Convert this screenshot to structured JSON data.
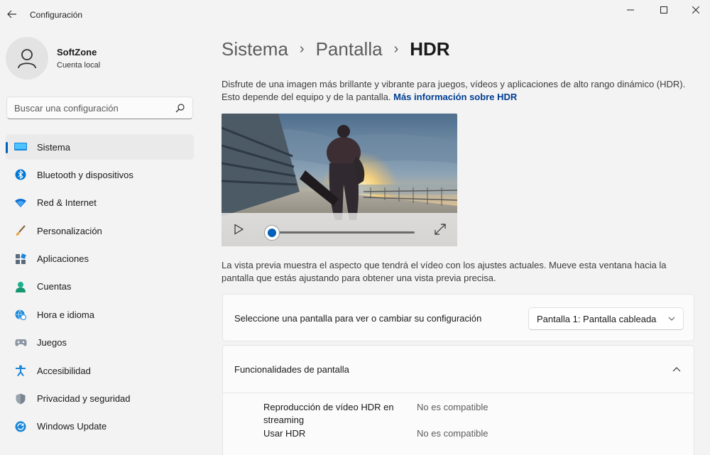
{
  "window": {
    "title": "Configuración"
  },
  "profile": {
    "name": "SoftZone",
    "account_type": "Cuenta local"
  },
  "search": {
    "placeholder": "Buscar una configuración"
  },
  "sidebar": {
    "items": [
      {
        "label": "Sistema",
        "icon": "system-icon",
        "active": true
      },
      {
        "label": "Bluetooth y dispositivos",
        "icon": "bluetooth-icon"
      },
      {
        "label": "Red & Internet",
        "icon": "wifi-icon"
      },
      {
        "label": "Personalización",
        "icon": "brush-icon"
      },
      {
        "label": "Aplicaciones",
        "icon": "apps-icon"
      },
      {
        "label": "Cuentas",
        "icon": "person-icon"
      },
      {
        "label": "Hora e idioma",
        "icon": "globe-clock-icon"
      },
      {
        "label": "Juegos",
        "icon": "gamepad-icon"
      },
      {
        "label": "Accesibilidad",
        "icon": "accessibility-icon"
      },
      {
        "label": "Privacidad y seguridad",
        "icon": "shield-icon"
      },
      {
        "label": "Windows Update",
        "icon": "update-icon"
      }
    ]
  },
  "breadcrumb": {
    "level1": "Sistema",
    "level2": "Pantalla",
    "current": "HDR"
  },
  "description": {
    "text": "Disfrute de una imagen más brillante y vibrante para juegos, vídeos y aplicaciones de alto rango dinámico (HDR). Esto depende del equipo y de la pantalla.",
    "link": "Más información sobre HDR"
  },
  "player": {
    "progress": 0
  },
  "preview_note": "La vista previa muestra el aspecto que tendrá el vídeo con los ajustes actuales. Mueve esta ventana hacia la pantalla que estás ajustando para obtener una vista previa precisa.",
  "display_select": {
    "label": "Seleccione una pantalla para ver o cambiar su configuración",
    "selected": "Pantalla 1: Pantalla cableada"
  },
  "features": {
    "title": "Funcionalidades de pantalla",
    "rows": [
      {
        "label": "Reproducción de vídeo HDR en streaming",
        "value": "No es compatible"
      },
      {
        "label": "Usar HDR",
        "value": "No es compatible"
      }
    ]
  },
  "colors": {
    "accent": "#005fb8",
    "link": "#003e92",
    "background": "#f3f3f3"
  }
}
